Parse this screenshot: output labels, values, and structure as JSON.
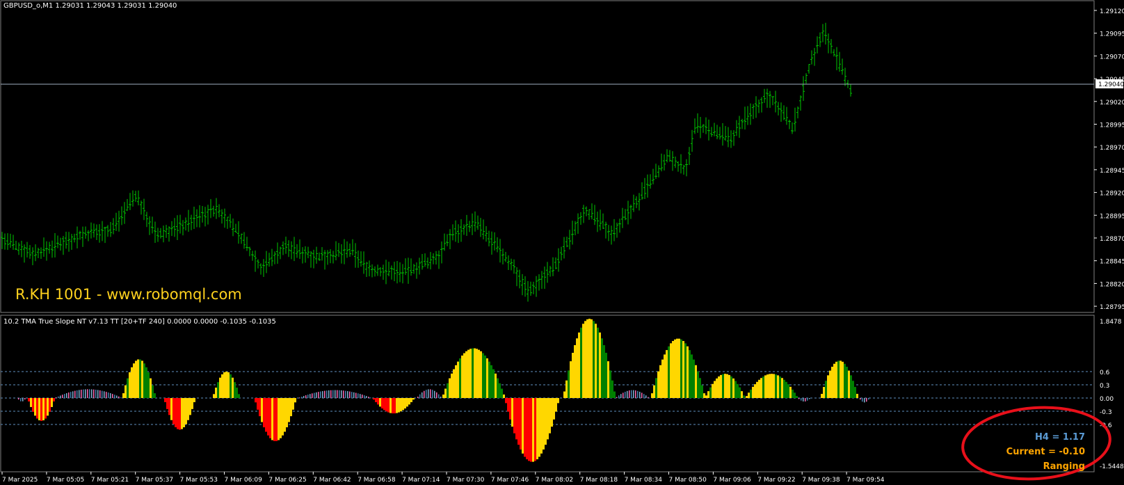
{
  "main_panel": {
    "header": "GBPUSD_o,M1  1.29031 1.29043 1.29031 1.29040",
    "watermark": "R.KH 1001 - www.robomql.com",
    "current_price_label": "1.29040",
    "current_price": 1.2904,
    "price_axis": [
      "1.29120",
      "1.29095",
      "1.29070",
      "1.29045",
      "1.29020",
      "1.28995",
      "1.28970",
      "1.28945",
      "1.28920",
      "1.28895",
      "1.28870",
      "1.28845",
      "1.28820",
      "1.28795"
    ]
  },
  "indicator_panel": {
    "header": "10.2 TMA True Slope NT v7.13 TT [20+TF 240] 0.0000 0.0000 -0.1035 -0.1035",
    "scale_top": "1.8478",
    "scale_bottom": "-1.5448",
    "levels": [
      "0.6",
      "0.3",
      "0.00",
      "-0.3",
      "-0.6"
    ],
    "level_values": [
      0.6,
      0.3,
      0.0,
      -0.3,
      -0.6
    ],
    "status": {
      "h4": "H4 = 1.17",
      "current": "Current = -0.10",
      "state": "Ranging"
    }
  },
  "time_axis": [
    "7 Mar 2025",
    "7 Mar 05:05",
    "7 Mar 05:21",
    "7 Mar 05:37",
    "7 Mar 05:53",
    "7 Mar 06:09",
    "7 Mar 06:25",
    "7 Mar 06:42",
    "7 Mar 06:58",
    "7 Mar 07:14",
    "7 Mar 07:30",
    "7 Mar 07:46",
    "7 Mar 08:02",
    "7 Mar 08:18",
    "7 Mar 08:34",
    "7 Mar 08:50",
    "7 Mar 09:06",
    "7 Mar 09:22",
    "7 Mar 09:38",
    "7 Mar 09:54"
  ],
  "colors": {
    "background": "#000000",
    "bars": "#00c800",
    "axis_text": "#ffffff",
    "watermark": "#ffd21e",
    "hist_yellow": "#ffd700",
    "hist_green": "#008000",
    "hist_red": "#ff0000",
    "level_line": "#5f8fbf",
    "h4_text": "#5b9bd5",
    "current_text": "#ffa500",
    "annotation_circle": "#e8101a"
  }
}
